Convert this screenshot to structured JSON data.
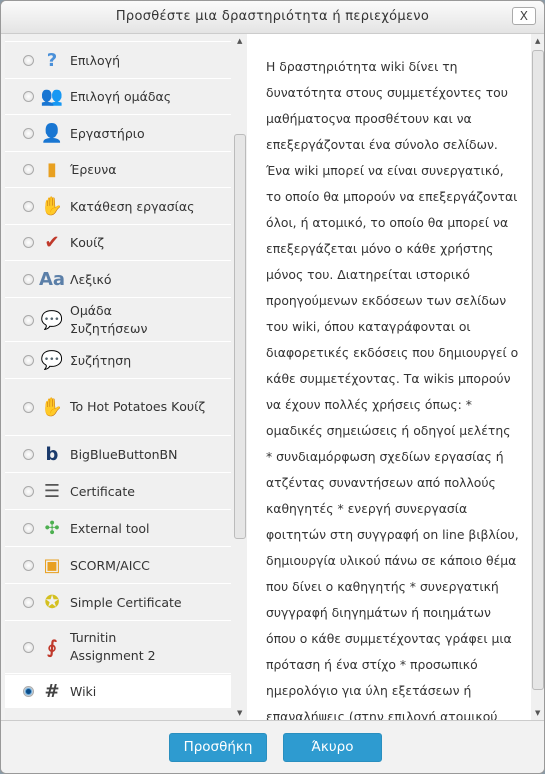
{
  "dialog": {
    "title": "Προσθέστε μια δραστηριότητα ή περιεχόμενο",
    "close_label": "X"
  },
  "items": [
    {
      "label": "Επιλογή",
      "icon": "question-icon",
      "color": "#4a90d9",
      "glyph": "?",
      "selected": false
    },
    {
      "label": "Επιλογή ομάδας",
      "icon": "group-icon",
      "color": "#e8651a",
      "glyph": "👥",
      "selected": false
    },
    {
      "label": "Εργαστήριο",
      "icon": "workshop-icon",
      "color": "#3a6fb0",
      "glyph": "👤",
      "selected": false
    },
    {
      "label": "Έρευνα",
      "icon": "bar-chart-icon",
      "color": "#e8a020",
      "glyph": "▮",
      "selected": false
    },
    {
      "label": "Κατάθεση εργασίας",
      "icon": "assignment-icon",
      "color": "#d9a070",
      "glyph": "✋",
      "selected": false
    },
    {
      "label": "Κουίζ",
      "icon": "checkmark-icon",
      "color": "#c0392b",
      "glyph": "✔",
      "selected": false
    },
    {
      "label": "Λεξικό",
      "icon": "glossary-icon",
      "color": "#5b7fa8",
      "glyph": "Aa",
      "selected": false
    },
    {
      "label": "Ομάδα Συζητήσεων",
      "icon": "forum-icon",
      "color": "#6ab04c",
      "glyph": "💬",
      "selected": false
    },
    {
      "label": "Συζήτηση",
      "icon": "chat-icon",
      "color": "#f0a020",
      "glyph": "💬",
      "selected": false
    },
    {
      "label": "To Hot Potatoes Κουίζ",
      "icon": "hotpot-icon",
      "color": "#8b4513",
      "glyph": "✋",
      "selected": false
    },
    {
      "label": "BigBlueButtonBN",
      "icon": "bigbluebutton-icon",
      "color": "#1a3a6b",
      "glyph": "b",
      "selected": false
    },
    {
      "label": "Certificate",
      "icon": "certificate-icon",
      "color": "#555555",
      "glyph": "☰",
      "selected": false
    },
    {
      "label": "External tool",
      "icon": "puzzle-icon",
      "color": "#4caf50",
      "glyph": "✣",
      "selected": false
    },
    {
      "label": "SCORM/AICC",
      "icon": "package-icon",
      "color": "#e8a020",
      "glyph": "▣",
      "selected": false
    },
    {
      "label": "Simple Certificate",
      "icon": "ribbon-icon",
      "color": "#d4c020",
      "glyph": "✪",
      "selected": false
    },
    {
      "label": "Turnitin Assignment 2",
      "icon": "turnitin-icon",
      "color": "#c0392b",
      "glyph": "∮",
      "selected": false
    },
    {
      "label": "Wiki",
      "icon": "wiki-icon",
      "color": "#444444",
      "glyph": "#",
      "selected": true
    }
  ],
  "description": "Η δραστηριότητα wiki δίνει τη δυνατότητα στους συμμετέχοντες του μαθήματοςνα προσθέτουν και να επεξεργάζονται ένα σύνολο σελίδων. Ένα wiki μπορεί να είναι συνεργατικό, το οποίο θα μπορούν να επεξεργάζονται όλοι, ή ατομικό, το οποίο θα μπορεί να επεξεργάζεται μόνο ο κάθε χρήστης μόνος του. Διατηρείται ιστορικό προηγούμενων εκδόσεων των σελίδων του wiki, όπου καταγράφονται οι διαφορετικές εκδόσεις που δημιουργεί ο κάθε συμμετέχοντας. Τα wikis μπορούν να έχουν πολλές χρήσεις όπως: * ομαδικές σημειώσεις ή οδηγοί μελέτης * συνδιαμόρφωση σχεδίων εργασίας ή ατζέντας συναντήσεων από πολλούς καθηγητές * ενεργή συνεργασία φοιτητών στη συγγραφή on line βιβλίου, δημιουργία υλικού πάνω σε κάποιο θέμα που δίνει ο καθηγητής * συνεργατική συγγραφή διηγημάτων ή ποιημάτων όπου ο κάθε συμμετέχοντας γράφει μια πρόταση ή ένα στίχο * προσωπικό ημερολόγιο για ύλη εξετάσεων ή επαναλήψεις (στην επιλογή ατομικού wiki)",
  "buttons": {
    "add": "Προσθήκη",
    "cancel": "Άκυρο"
  },
  "colors": {
    "accent": "#2e9bd0"
  }
}
